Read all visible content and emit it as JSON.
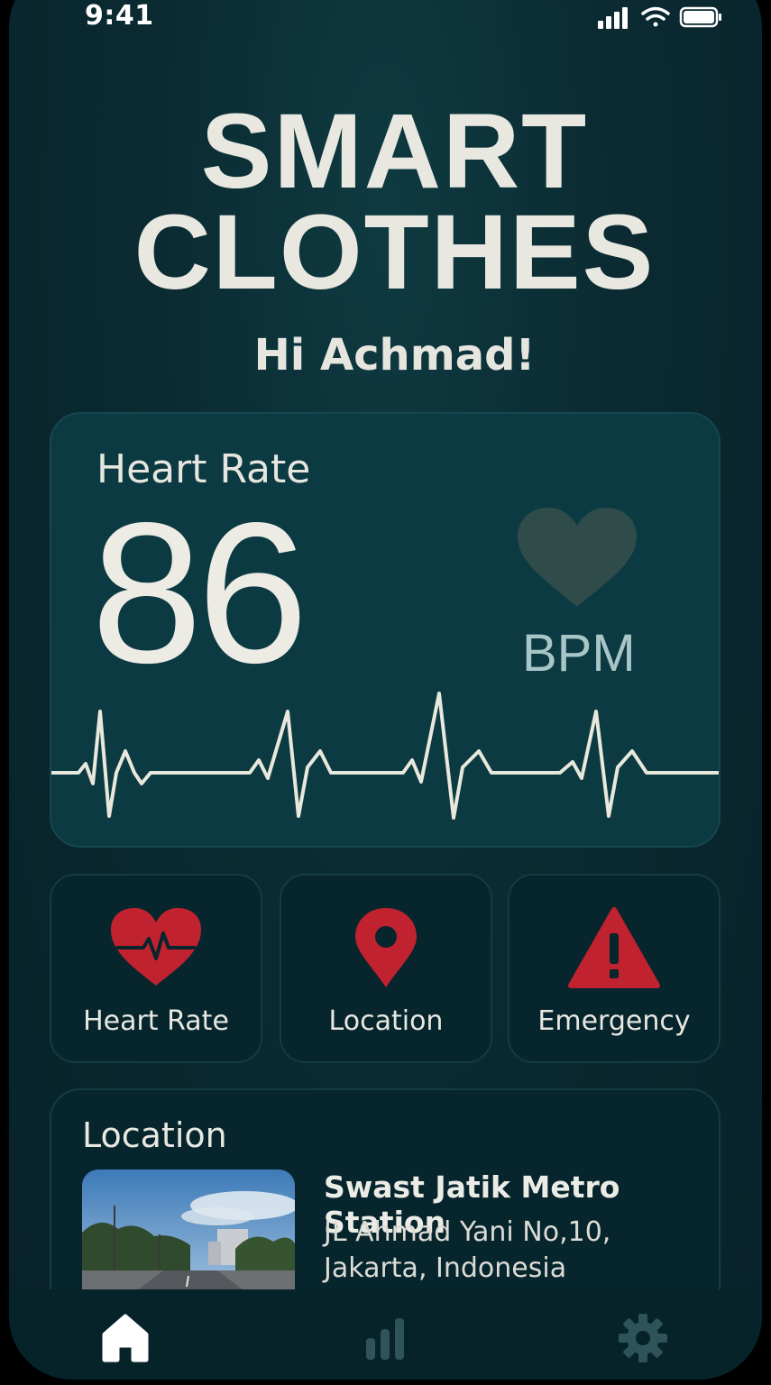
{
  "status_bar": {
    "time": "9:41"
  },
  "header": {
    "title_line1": "SMART",
    "title_line2": "CLOTHES",
    "greeting": "Hi Achmad!"
  },
  "heart_rate_card": {
    "title": "Heart Rate",
    "value": "86",
    "unit": "BPM",
    "heart_color": "#2f4c4b",
    "ecg_color": "#e8e8dc"
  },
  "tiles": [
    {
      "label": "Heart Rate",
      "icon": "heart-pulse-icon",
      "color": "#c0222f"
    },
    {
      "label": "Location",
      "icon": "map-pin-icon",
      "color": "#c0222f"
    },
    {
      "label": "Emergency",
      "icon": "warning-triangle-icon",
      "color": "#c0222f"
    }
  ],
  "location_card": {
    "title": "Location",
    "place_name": "Swast Jatik Metro Station",
    "address_line1": "JL Ahmad Yani No,10,",
    "address_line2": "Jakarta, Indonesia"
  },
  "bottom_nav": {
    "items": [
      "home-icon",
      "stats-icon",
      "settings-icon"
    ],
    "active": "home-icon",
    "active_color": "#ffffff",
    "inactive_color": "#2e5358"
  },
  "colors": {
    "background": "#0b2a31",
    "card": "#0c3a42",
    "text": "#e8e8e0",
    "accent_red": "#c0222f"
  }
}
